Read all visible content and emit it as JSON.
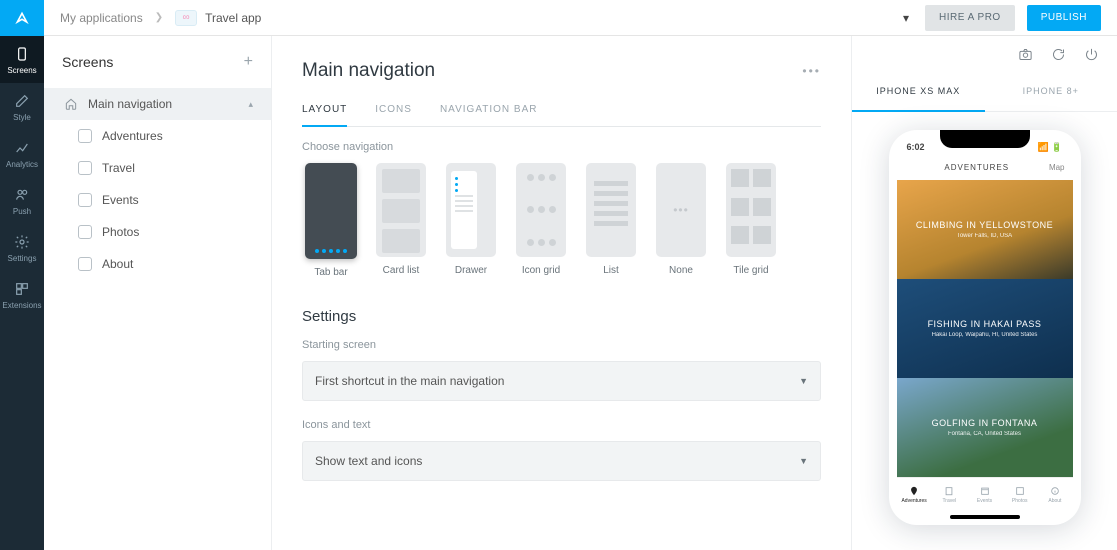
{
  "rail": {
    "items": [
      {
        "label": "Screens"
      },
      {
        "label": "Style"
      },
      {
        "label": "Analytics"
      },
      {
        "label": "Push"
      },
      {
        "label": "Settings"
      },
      {
        "label": "Extensions"
      }
    ]
  },
  "breadcrumb": {
    "root": "My applications",
    "app": "Travel app"
  },
  "topbar": {
    "hire": "HIRE A PRO",
    "publish": "PUBLISH"
  },
  "sidebar": {
    "title": "Screens",
    "items": [
      {
        "label": "Main navigation"
      },
      {
        "label": "Adventures"
      },
      {
        "label": "Travel"
      },
      {
        "label": "Events"
      },
      {
        "label": "Photos"
      },
      {
        "label": "About"
      }
    ]
  },
  "editor": {
    "title": "Main navigation",
    "tabs": [
      "LAYOUT",
      "ICONS",
      "NAVIGATION BAR"
    ],
    "choose_label": "Choose navigation",
    "nav_options": [
      "Tab bar",
      "Card list",
      "Drawer",
      "Icon grid",
      "List",
      "None",
      "Tile grid"
    ],
    "settings_title": "Settings",
    "starting_label": "Starting screen",
    "starting_value": "First shortcut in the main navigation",
    "icons_label": "Icons and text",
    "icons_value": "Show text and icons"
  },
  "preview": {
    "devices": [
      "IPHONE XS MAX",
      "IPHONE 8+"
    ],
    "time": "6:02",
    "header": "ADVENTURES",
    "header_right": "Map",
    "cards": [
      {
        "title": "CLIMBING IN YELLOWSTONE",
        "sub": "Tower Falls, ID, USA"
      },
      {
        "title": "FISHING IN HAKAI PASS",
        "sub": "Hakai Loop, Waipahu, HI, United States"
      },
      {
        "title": "GOLFING IN FONTANA",
        "sub": "Fontana, CA, United States"
      }
    ],
    "tabs": [
      "Adventures",
      "Travel",
      "Events",
      "Photos",
      "About"
    ]
  }
}
